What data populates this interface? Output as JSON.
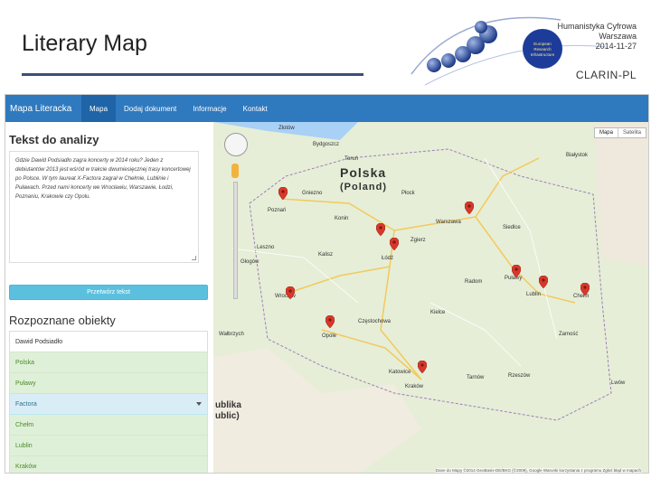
{
  "slide": {
    "title": "Literary Map",
    "org_line1": "Humanistyka Cyfrowa",
    "org_line2": "Warszawa",
    "org_date": "2014-11-27",
    "brand": "CLARIN-PL",
    "logo_text": [
      "European",
      "Research",
      "Infrastructure"
    ],
    "accent": "#3b4f78"
  },
  "app": {
    "brand": "Mapa Literacka",
    "nav": [
      "Mapa",
      "Dodaj dokument",
      "Informacje",
      "Kontakt"
    ],
    "nav_active_color": "#1e64a6",
    "navbar_color": "#2f79bf"
  },
  "analysis": {
    "heading": "Tekst do analizy",
    "text": "Gdzie Dawid Podsiadło zagra koncerty w 2014 roku? Jeden z debiutantów 2013 jest wśród w trakcie dwumiesięcznej trasy koncertowej po Polsce. W tym laureat X-Factora zagrał w Chełmie, Lublinie i Puławach. Przed nami koncerty we Wrocławiu, Warszawie, Łodzi, Poznaniu, Krakowie czy Opolu.",
    "button": "Przetwórz tekst"
  },
  "recognized": {
    "heading": "Rozpoznane obiekty",
    "items": [
      "Dawid Podsiadło",
      "Polska",
      "Puławy",
      "Factora",
      "Chełm",
      "Lublin",
      "Kraków"
    ]
  },
  "map": {
    "country": "Polska",
    "country_sub": "(Poland)",
    "map_type_1": "Mapa",
    "map_type_2": "Satelita",
    "attribution": "Dane do Mapy ©2014 GeoBasis-DE/BKG (©2009), Google   Warunki korzystania z programu   Zgłoś błąd w mapach",
    "side_label_1": "ublika",
    "side_label_2": "ublic)",
    "labels": {
      "zlotow": "Złotów",
      "bydgoszcz": "Bydgoszcz",
      "torun": "Toruń",
      "gniezno": "Gniezno",
      "poznan": "Poznań",
      "konin": "Konin",
      "plock": "Płock",
      "warszawa": "Warszawa",
      "siedlce": "Siedlce",
      "bialystok": "Białystok",
      "lodz": "Łódź",
      "kalisz": "Kalisz",
      "leszno": "Leszno",
      "wroclaw": "Wrocław",
      "opole": "Opole",
      "czestochowa": "Częstochowa",
      "kielce": "Kielce",
      "radom": "Radom",
      "pulawy": "Puławy",
      "lublin": "Lublin",
      "chelm": "Chełm",
      "katowice": "Katowice",
      "krakow": "Kraków",
      "tarnow": "Tarnów",
      "rzeszow": "Rzeszów",
      "zamosc": "Zamość",
      "lwow": "Lwów",
      "walbrzych": "Wałbrzych",
      "zgierz": "Zgierz",
      "glogow": "Głogów"
    },
    "marker_color": "#d9372b"
  }
}
